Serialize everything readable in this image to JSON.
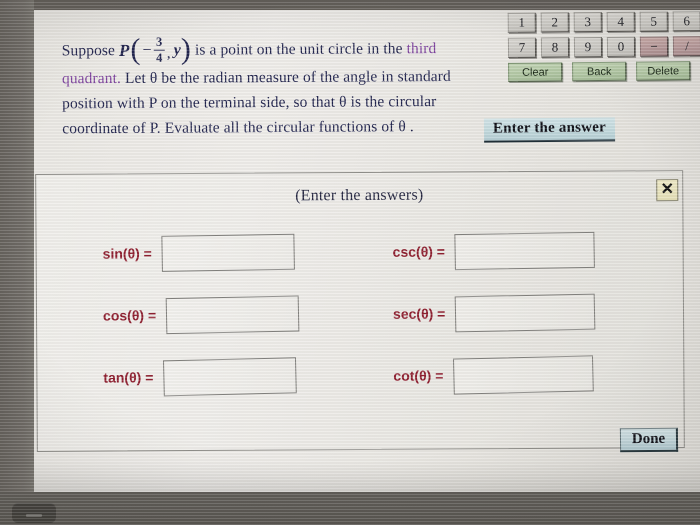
{
  "problem": {
    "line1_pre": "Suppose ",
    "point_var": "P",
    "fraction_numerator": "3",
    "fraction_denominator": "4",
    "point_second_coord": "y",
    "line1_mid": " is a point on the unit circle in the ",
    "line1_highlight": "third",
    "line2_highlight": "quadrant.",
    "line2_rest": " Let θ be the radian measure of the angle in standard",
    "line3": "position with P on the terminal side, so that θ is the circular",
    "line4": "coordinate of P. Evaluate all the circular functions of θ ."
  },
  "keypad": {
    "row1": [
      "1",
      "2",
      "3",
      "4",
      "5",
      "6"
    ],
    "row2": [
      "7",
      "8",
      "9",
      "0",
      "−",
      "/"
    ],
    "operator_keys": [
      "−",
      "/"
    ],
    "actions": [
      "Clear",
      "Back",
      "Delete"
    ]
  },
  "banner": {
    "enter_answer_label": "Enter the answer"
  },
  "panel": {
    "title": "(Enter the answers)",
    "close_label": "✕",
    "rows": [
      {
        "left_label": "sin(θ) =",
        "left_value": "",
        "right_label": "csc(θ)  =",
        "right_value": ""
      },
      {
        "left_label": "cos(θ) =",
        "left_value": "",
        "right_label": "sec(θ)  =",
        "right_value": ""
      },
      {
        "left_label": "tan(θ) =",
        "left_value": "",
        "right_label": "cot(θ)  =",
        "right_value": ""
      }
    ],
    "done_label": "Done"
  },
  "colors": {
    "problem_text": "#1c1f4a",
    "highlight_purple": "#7b3f9d",
    "function_label_maroon": "#8c1a2b",
    "banner_blue": "#c3dade",
    "close_button_cream": "#e4dfb6",
    "action_key_green": "#b0c6a2",
    "operator_key_mauve": "#b8999a"
  }
}
